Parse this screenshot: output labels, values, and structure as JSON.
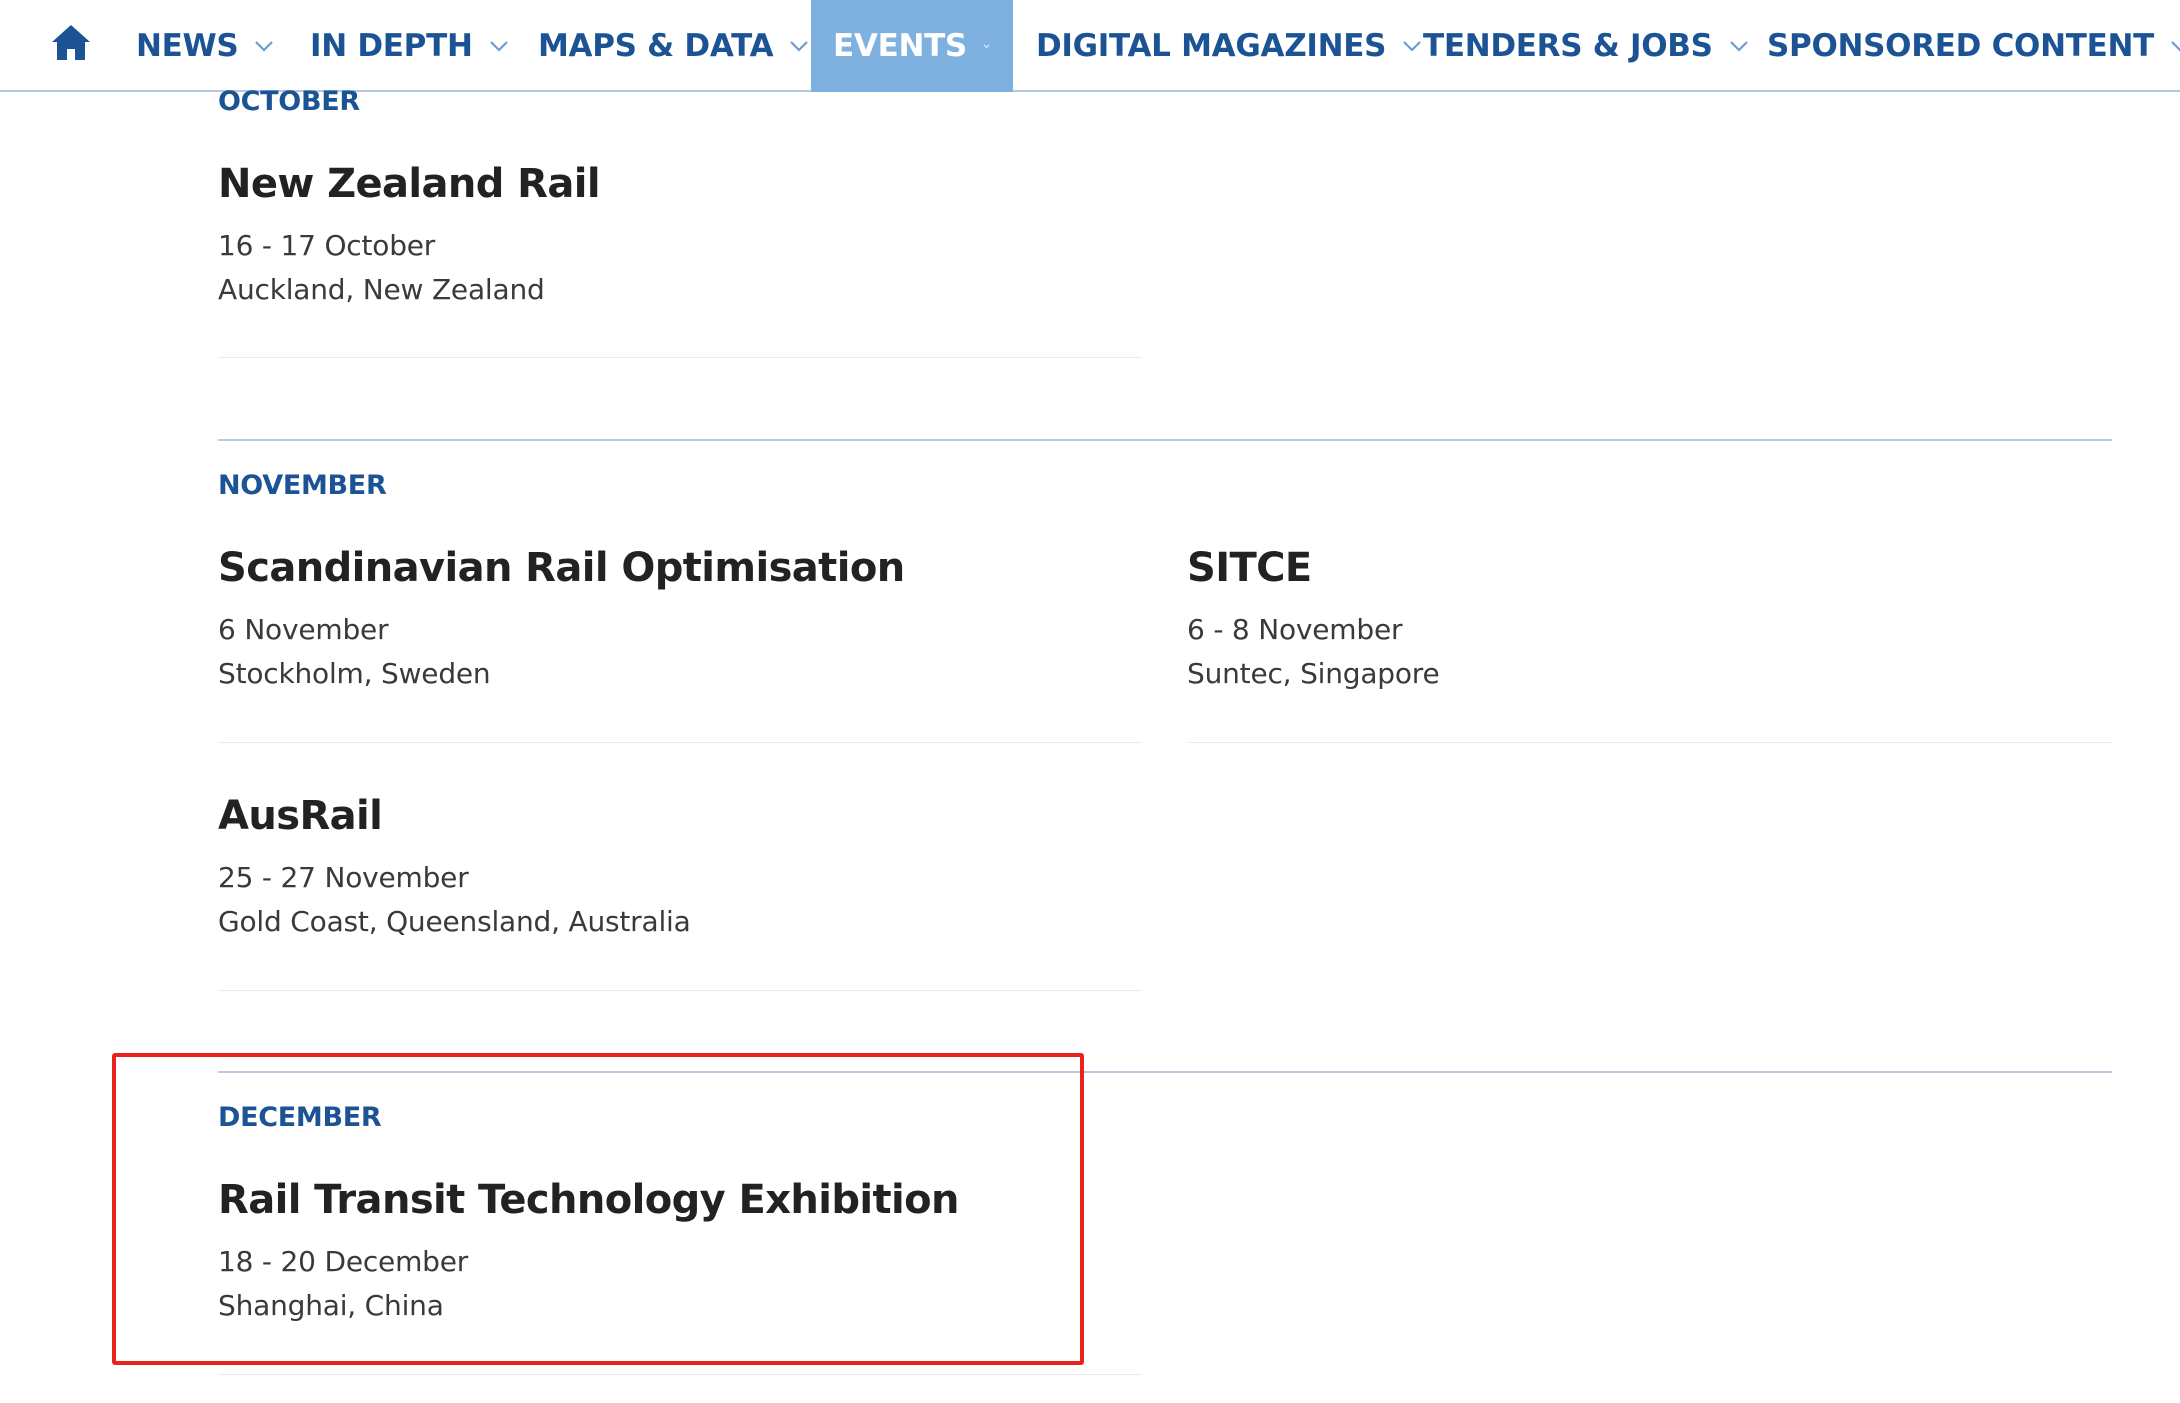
{
  "nav": {
    "items": [
      {
        "label": "NEWS"
      },
      {
        "label": "IN DEPTH"
      },
      {
        "label": "MAPS & DATA"
      },
      {
        "label": "EVENTS",
        "active": true
      },
      {
        "label": "DIGITAL MAGAZINES"
      },
      {
        "label": "TENDERS & JOBS"
      },
      {
        "label": "SPONSORED CONTENT"
      }
    ]
  },
  "sections": [
    {
      "month": "OCTOBER",
      "events": [
        {
          "title": "New Zealand Rail",
          "date": "16 - 17 October",
          "location": "Auckland, New Zealand"
        }
      ]
    },
    {
      "month": "NOVEMBER",
      "events": [
        {
          "title": "Scandinavian Rail Optimisation",
          "date": "6 November",
          "location": "Stockholm, Sweden"
        },
        {
          "title": "SITCE",
          "date": "6 - 8 November",
          "location": "Suntec, Singapore"
        },
        {
          "title": "AusRail",
          "date": "25 - 27 November",
          "location": "Gold Coast, Queensland, Australia"
        }
      ]
    },
    {
      "month": "DECEMBER",
      "events": [
        {
          "title": "Rail Transit Technology Exhibition",
          "date": "18 - 20 December",
          "location": "Shanghai, China"
        }
      ]
    }
  ],
  "colors": {
    "nav_text": "#1b5394",
    "nav_active_bg": "#7eb0e0",
    "month_text": "#1b5394",
    "highlight_border": "#e8231c"
  }
}
